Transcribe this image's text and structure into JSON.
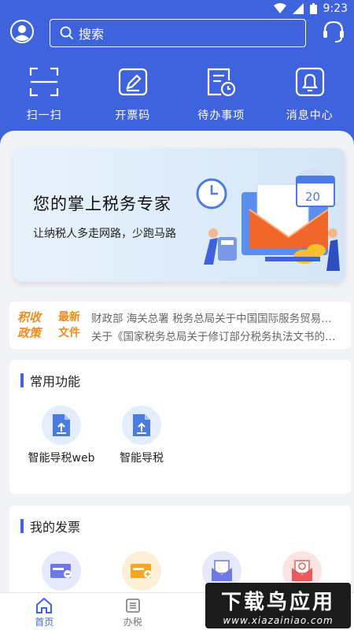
{
  "status": {
    "time": "9:23"
  },
  "search": {
    "placeholder": "搜索"
  },
  "quick_actions": [
    {
      "label": "扫一扫",
      "icon": "scan-icon"
    },
    {
      "label": "开票码",
      "icon": "invoice-code-icon"
    },
    {
      "label": "待办事项",
      "icon": "todo-icon"
    },
    {
      "label": "消息中心",
      "icon": "bell-icon"
    }
  ],
  "banner": {
    "title": "您的掌上税务专家",
    "subtitle": "让纳税人多走网路，少跑马路",
    "calendar_day": "20"
  },
  "news": {
    "tag_left": "积收政策",
    "tag_right": "最新文件",
    "lines": [
      "财政部 海关总署 税务总局关于中国国际服务贸易交易会展期内销售的进口展品税收政策的通知",
      "关于《国家税务总局关于修订部分税务执法文书的公告》的解读"
    ]
  },
  "common": {
    "title": "常用功能",
    "items": [
      {
        "label": "智能导税web"
      },
      {
        "label": "智能导税"
      }
    ]
  },
  "invoices": {
    "title": "我的发票"
  },
  "tabs": [
    {
      "label": "首页",
      "active": true
    },
    {
      "label": "办税",
      "active": false
    }
  ],
  "watermark": {
    "title": "下载鸟应用",
    "url": "www.xiazainiao.com"
  },
  "colors": {
    "primary": "#3e63dd",
    "accent": "#f08b1d",
    "background": "#f2f3f7"
  }
}
